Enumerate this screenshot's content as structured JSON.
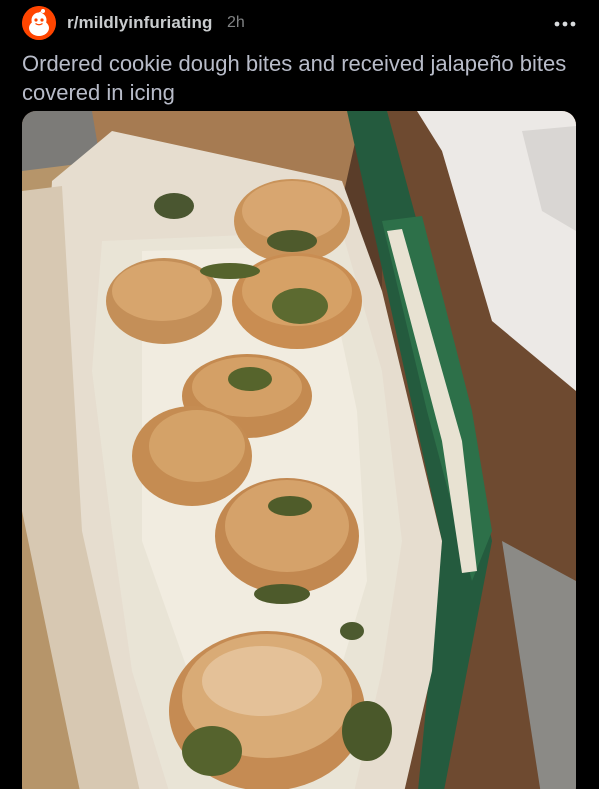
{
  "post": {
    "subreddit": "r/mildlyinfuriating",
    "age": "2h",
    "title": "Ordered cookie dough bites and received jalapeño bites covered in icing"
  },
  "icons": {
    "avatar": "reddit-snoo-icon",
    "more": "more-options-icon"
  },
  "colors": {
    "background": "#000000",
    "accent": "#ff4500",
    "title_text": "#b8bcc9",
    "meta_text": "#818384"
  }
}
